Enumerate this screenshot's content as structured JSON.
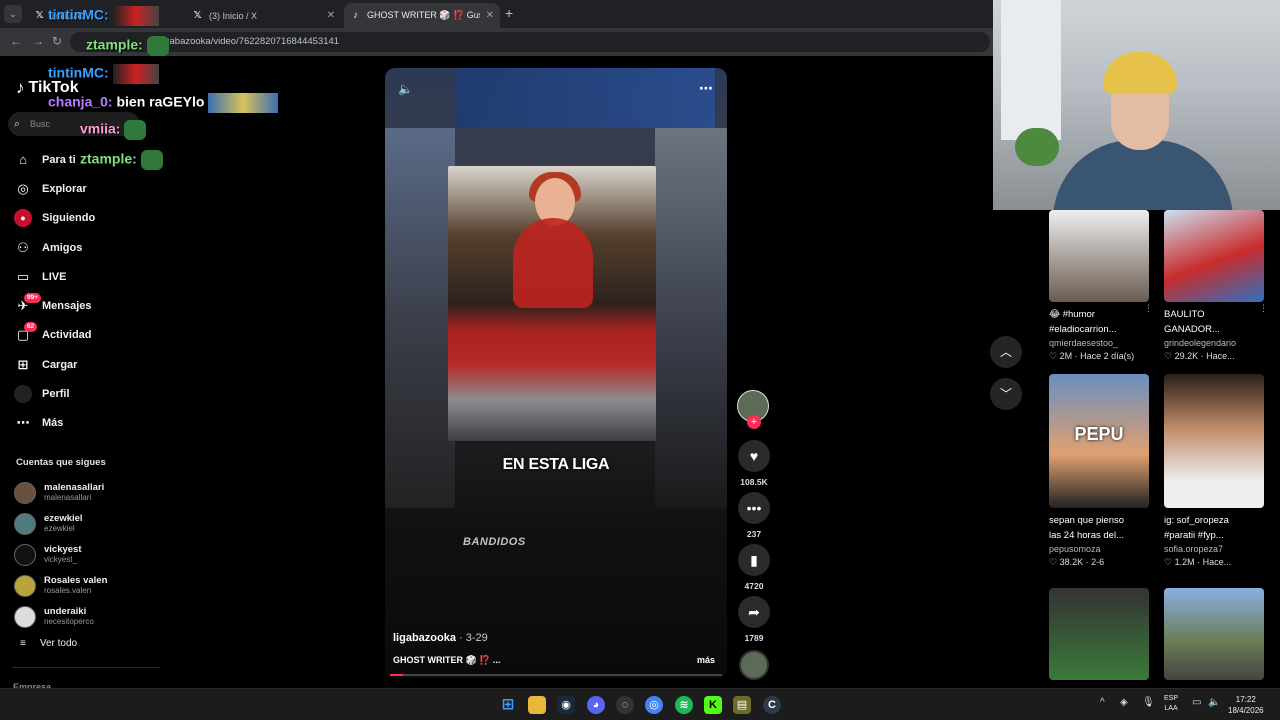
{
  "browser": {
    "tabs": [
      {
        "title": "tintinMC:",
        "favicon": "x-icon",
        "active": false
      },
      {
        "title": "(3) Inicio / X",
        "favicon": "x-icon",
        "active": false
      },
      {
        "title": "GHOST WRITER 🎲 ⁉️ Gus",
        "favicon": "tiktok-icon",
        "active": true
      }
    ],
    "url": "ligabazooka/video/7622820716844453141"
  },
  "chat": [
    {
      "user": "tintinMC:",
      "message": ""
    },
    {
      "user": "ztample:",
      "message": ""
    },
    {
      "user": "tintinMC:",
      "message": ""
    },
    {
      "user": "chanja_0:",
      "message": "bien raGEYlo"
    },
    {
      "user": "vmiia:",
      "message": ""
    },
    {
      "user": "ztample:",
      "message": ""
    }
  ],
  "sidebar": {
    "logo": "TikTok",
    "search_placeholder": "Busc",
    "nav": [
      {
        "label": "Para ti",
        "icon": "home-icon"
      },
      {
        "label": "Explorar",
        "icon": "compass-icon"
      },
      {
        "label": "Siguiendo",
        "icon": "following-icon"
      },
      {
        "label": "Amigos",
        "icon": "friends-icon"
      },
      {
        "label": "LIVE",
        "icon": "live-icon"
      },
      {
        "label": "Mensajes",
        "icon": "messages-icon",
        "badge": "99+"
      },
      {
        "label": "Actividad",
        "icon": "activity-icon",
        "badge": "62"
      },
      {
        "label": "Cargar",
        "icon": "upload-icon"
      },
      {
        "label": "Perfil",
        "icon": "profile-icon"
      },
      {
        "label": "Más",
        "icon": "more-icon"
      }
    ],
    "following_title": "Cuentas que sigues",
    "following": [
      {
        "name": "malenasallari",
        "handle": "malenasallari"
      },
      {
        "name": "ezewkiel",
        "handle": "ezewkiel"
      },
      {
        "name": "vickyest",
        "handle": "vickyest_"
      },
      {
        "name": "Rosales valen",
        "handle": "rosales.valen"
      },
      {
        "name": "underaiki",
        "handle": "necesitoperco"
      }
    ],
    "see_all": "Ver todo",
    "footer": "Empresa"
  },
  "video": {
    "caption_overlay": "EN ESTA LIGA",
    "watermark": "BANDIDOS",
    "author": "ligabazooka",
    "date": "· 3-29",
    "description": "GHOST WRITER 🎲 ⁉️ ...",
    "more": "más",
    "progress": 0.04
  },
  "actions": {
    "likes": "108.5K",
    "comments": "237",
    "saves": "4720",
    "shares": "1789"
  },
  "suggestions": [
    {
      "line1": "😂 #humor",
      "line2": "#eladiocarrion...",
      "author": "qmierdaesestoo_",
      "stats": "♡ 2M · Hace 2 día(s)"
    },
    {
      "line1": "BAULITO",
      "line2": "GANADOR...",
      "author": "grindeolegendario",
      "stats": "♡ 29.2K · Hace..."
    },
    {
      "line1": "sepan que pienso",
      "line2": "las 24 horas del...",
      "author": "pepusomoza",
      "stats": "♡ 38.2K · 2-6",
      "overlay": "PEPU"
    },
    {
      "line1": "ig: sof_oropeza",
      "line2": "#paratii #fyp...",
      "author": "sofia.oropeza7",
      "stats": "♡ 1.2M · Hace..."
    }
  ],
  "taskbar": {
    "lang_top": "ESP",
    "lang_bottom": "LAA",
    "time": "17:22",
    "date": "18/4/2026"
  },
  "colors": {
    "accent": "#fe2c55",
    "background": "#000000",
    "chrome": "#202124"
  }
}
